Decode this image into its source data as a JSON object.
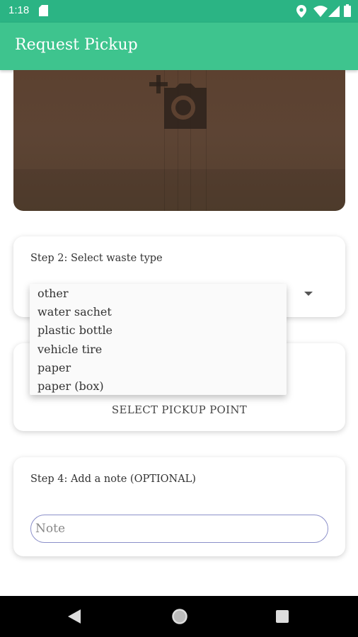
{
  "status_bar": {
    "time": "1:18"
  },
  "app_bar": {
    "title": "Request Pickup"
  },
  "step2": {
    "label": "Step 2: Select waste type",
    "options": [
      "other",
      "water sachet",
      "plastic bottle",
      "vehicle tire",
      "paper",
      "paper (box)"
    ]
  },
  "step3": {
    "button_label": "SELECT PICKUP POINT"
  },
  "step4": {
    "label": "Step 4: Add a note (OPTIONAL)",
    "note_placeholder": "Note",
    "note_value": ""
  },
  "colors": {
    "status_bar": "#2bb484",
    "app_bar": "#3ec48e",
    "field_border": "#8b8fc9"
  },
  "icons": [
    "sd-card-icon",
    "location-icon",
    "wifi-icon",
    "signal-icon",
    "battery-icon",
    "add-photo-icon",
    "dropdown-arrow-icon",
    "back-icon",
    "home-icon",
    "recents-icon"
  ]
}
